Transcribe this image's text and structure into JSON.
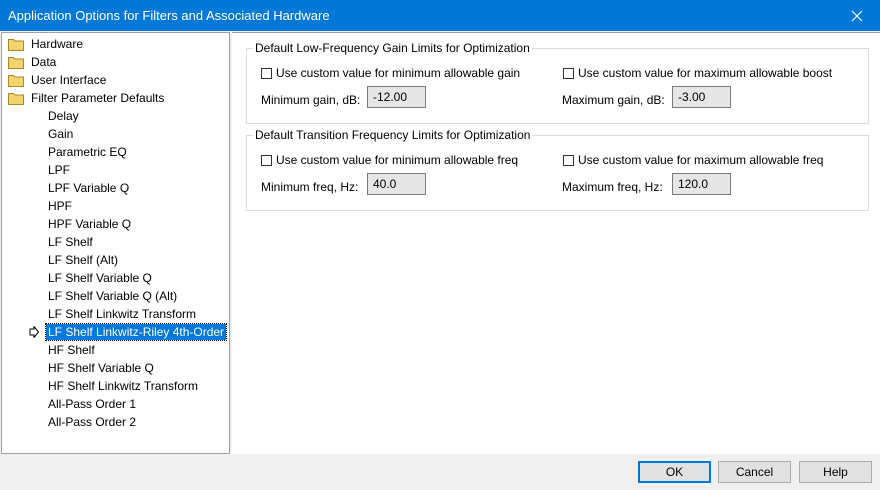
{
  "window": {
    "title": "Application Options for Filters and Associated Hardware"
  },
  "tree": {
    "folders": [
      "Hardware",
      "Data",
      "User Interface",
      "Filter Parameter Defaults"
    ],
    "items": [
      "Delay",
      "Gain",
      "Parametric EQ",
      "LPF",
      "LPF Variable Q",
      "HPF",
      "HPF Variable Q",
      "LF Shelf",
      "LF Shelf (Alt)",
      "LF Shelf Variable Q",
      "LF Shelf Variable Q (Alt)",
      "LF Shelf Linkwitz Transform",
      "LF Shelf Linkwitz-Riley 4th-Order",
      "HF Shelf",
      "HF Shelf Variable Q",
      "HF Shelf Linkwitz Transform",
      "All-Pass Order 1",
      "All-Pass Order 2"
    ],
    "selected": "LF Shelf Linkwitz-Riley 4th-Order"
  },
  "gain_group": {
    "title": "Default Low-Frequency Gain Limits for Optimization",
    "cb_min": "Use custom value for minimum allowable gain",
    "cb_max": "Use custom value for maximum allowable boost",
    "min_label": "Minimum gain, dB:",
    "min_value": "-12.00",
    "max_label": "Maximum gain, dB:",
    "max_value": "-3.00"
  },
  "freq_group": {
    "title": "Default Transition Frequency Limits for Optimization",
    "cb_min": "Use custom value for minimum allowable freq",
    "cb_max": "Use custom value for maximum allowable freq",
    "min_label": "Minimum freq, Hz:",
    "min_value": "40.0",
    "max_label": "Maximum freq, Hz:",
    "max_value": "120.0"
  },
  "buttons": {
    "ok": "OK",
    "cancel": "Cancel",
    "help": "Help"
  },
  "colors": {
    "titlebar": "#0078d7",
    "selection": "#0078d7",
    "folder": "#f3d36b"
  },
  "icons": {
    "close": "close-icon",
    "folder": "folder-icon",
    "pointer": "arrow-right-icon"
  }
}
